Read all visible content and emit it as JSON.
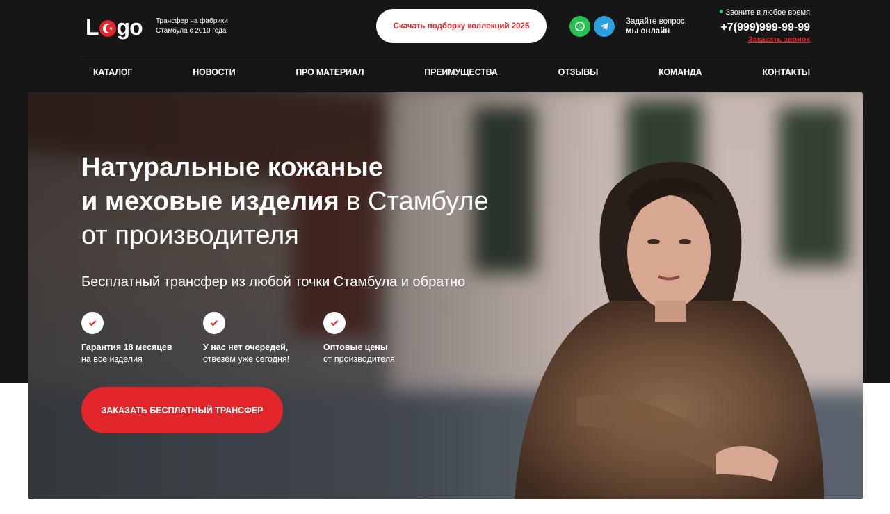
{
  "colors": {
    "accent": "#e3262b",
    "dark": "#161616",
    "whatsapp": "#25c251",
    "telegram": "#2aa0de",
    "online": "#22c55e"
  },
  "header": {
    "logo_text_start": "L",
    "logo_text_end": "go",
    "tagline_line1": "Трансфер на фабрики",
    "tagline_line2": "Стамбула с 2010 года",
    "download_label": "Скачать подборку коллекций 2025",
    "social_icons": [
      "whatsapp-icon",
      "telegram-icon"
    ],
    "ask_line1": "Задайте вопрос,",
    "ask_line2": "мы онлайн",
    "call_hours": "Звоните в любое время",
    "phone": "+7(999)999-99-99",
    "callback_label": "Заказать звонок"
  },
  "nav": {
    "items": [
      {
        "label": "КАТАЛОГ"
      },
      {
        "label": "НОВОСТИ"
      },
      {
        "label": "ПРО МАТЕРИАЛ"
      },
      {
        "label": "ПРЕИМУЩЕСТВА"
      },
      {
        "label": "ОТЗЫВЫ"
      },
      {
        "label": "КОМАНДА"
      },
      {
        "label": "КОНТАКТЫ"
      }
    ]
  },
  "hero": {
    "title_line1": "Натуральные кожаные",
    "title_line2_bold": "и меховые изделия",
    "title_line2_regular": " в Стамбуле",
    "title_line3": "от производителя",
    "subtitle": "Бесплатный трансфер из любой точки Стамбула и обратно",
    "features": [
      {
        "title": "Гарантия 18 месяцев",
        "text": "на все изделия"
      },
      {
        "title": "У нас нет очередей,",
        "text": "отвезём уже сегодня!"
      },
      {
        "title": "Оптовые цены",
        "text": "от производителя"
      }
    ],
    "cta_label": "ЗАКАЗАТЬ БЕСПЛАТНЫЙ ТРАНСФЕР"
  }
}
